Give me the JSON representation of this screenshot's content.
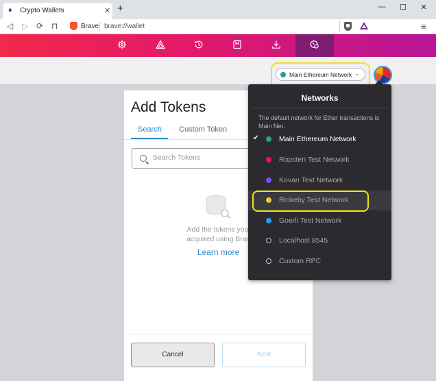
{
  "browser": {
    "tab_title": "Crypto Wallets",
    "tab_close": "✕",
    "new_tab": "+",
    "window_controls": {
      "minimize": "—",
      "maximize": "☐",
      "close": "✕"
    },
    "nav": {
      "back": "◁",
      "forward": "▷",
      "reload": "⟳",
      "bookmark": "⊓"
    },
    "omnibox_brand": "Brave",
    "omnibox_url": "brave://wallet",
    "menu_icon": "≡"
  },
  "wallet_nav": {
    "items": [
      {
        "icon": "settings-icon"
      },
      {
        "icon": "rewards-triangle-icon"
      },
      {
        "icon": "history-icon"
      },
      {
        "icon": "bookmarks-icon"
      },
      {
        "icon": "downloads-icon"
      },
      {
        "icon": "wallet-icon",
        "active": true
      }
    ]
  },
  "network_selector": {
    "label": "Main Ethereum Network",
    "chevron": "⌄",
    "dot_color": "#2f9b8f"
  },
  "add_tokens": {
    "title": "Add Tokens",
    "tabs": [
      "Search",
      "Custom Token"
    ],
    "search_placeholder": "Search Tokens",
    "empty_line1": "Add the tokens you'",
    "empty_line2": "acquired using Brav",
    "learn_more": "Learn more",
    "cancel": "Cancel",
    "next": "Next"
  },
  "networks_dropdown": {
    "title": "Networks",
    "description": "The default network for Ether transactions is Main Net.",
    "check_mark": "✔",
    "items": [
      {
        "label": "Main Ethereum Network",
        "color": "#2f9b8f",
        "selected": true
      },
      {
        "label": "Ropsten Test Network",
        "color": "#e91550"
      },
      {
        "label": "Kovan Test Network",
        "color": "#7b52e8"
      },
      {
        "label": "Rinkeby Test Network",
        "color": "#f6c343",
        "highlighted": true
      },
      {
        "label": "Goerli Test Network",
        "color": "#3099f2"
      },
      {
        "label": "Localhost 8545",
        "color": "ring"
      },
      {
        "label": "Custom RPC",
        "color": "ring"
      }
    ]
  },
  "colors": {
    "accent_blue": "#2e8dcb",
    "annotation_yellow": "#f1e21a",
    "dropdown_bg": "#2b2b2f"
  }
}
